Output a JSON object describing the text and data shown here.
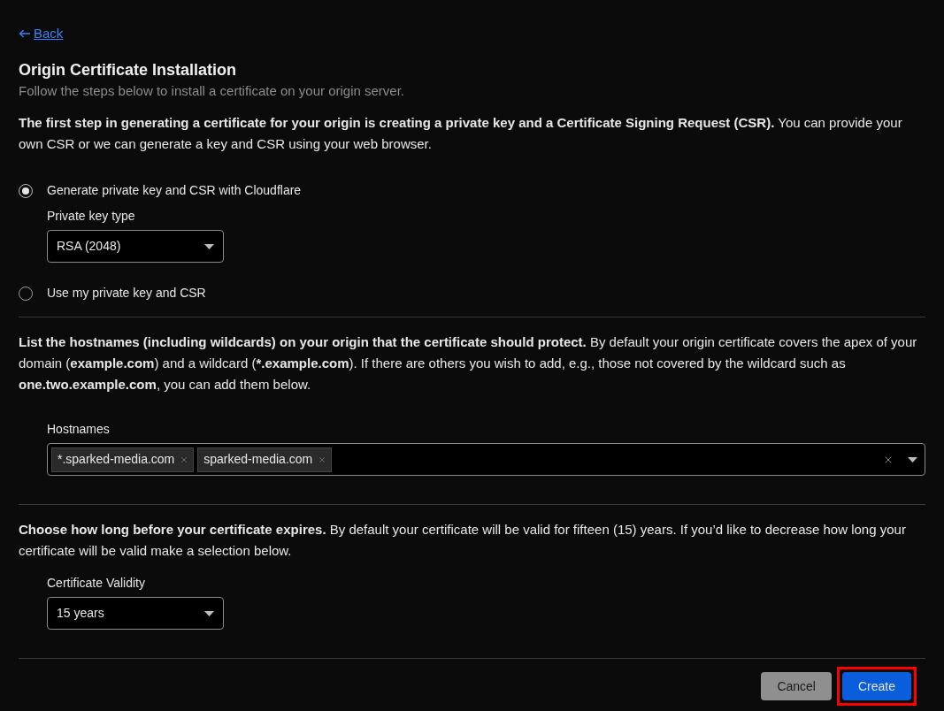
{
  "back_link": "Back",
  "title": "Origin Certificate Installation",
  "subtitle": "Follow the steps below to install a certificate on your origin server.",
  "key_section": {
    "intro": "**The first step in generating a certificate for your origin is creating a private key and a Certificate Signing Request (CSR).** You can provide your own CSR or we can generate a key and CSR using your web browser.",
    "options": [
      {
        "label": "Generate private key and CSR with Cloudflare",
        "selected": true,
        "field": {
          "label": "Private key type",
          "value": "RSA (2048)"
        }
      },
      {
        "label": "Use my private key and CSR",
        "selected": false
      }
    ]
  },
  "hostnames_section": {
    "intro": "**List the hostnames (including wildcards) on your origin that the certificate should protect.** By default your origin certificate covers the apex of your domain (**example.com**) and a wildcard (***.example.com**). If there are others you wish to add, e.g., those not covered by the wildcard such as **one.two.example.com**, you can add them below.",
    "field_label": "Hostnames",
    "tags": [
      "*.sparked-media.com",
      "sparked-media.com"
    ]
  },
  "validity_section": {
    "intro": "**Choose how long before your certificate expires.** By default your certificate will be valid for fifteen (15) years. If you’d like to decrease how long your certificate will be valid make a selection below.",
    "field_label": "Certificate Validity",
    "value": "15 years"
  },
  "buttons": [
    {
      "label": "Cancel",
      "kind": "secondary",
      "highlighted": false
    },
    {
      "label": "Create",
      "kind": "primary",
      "highlighted": true
    }
  ]
}
